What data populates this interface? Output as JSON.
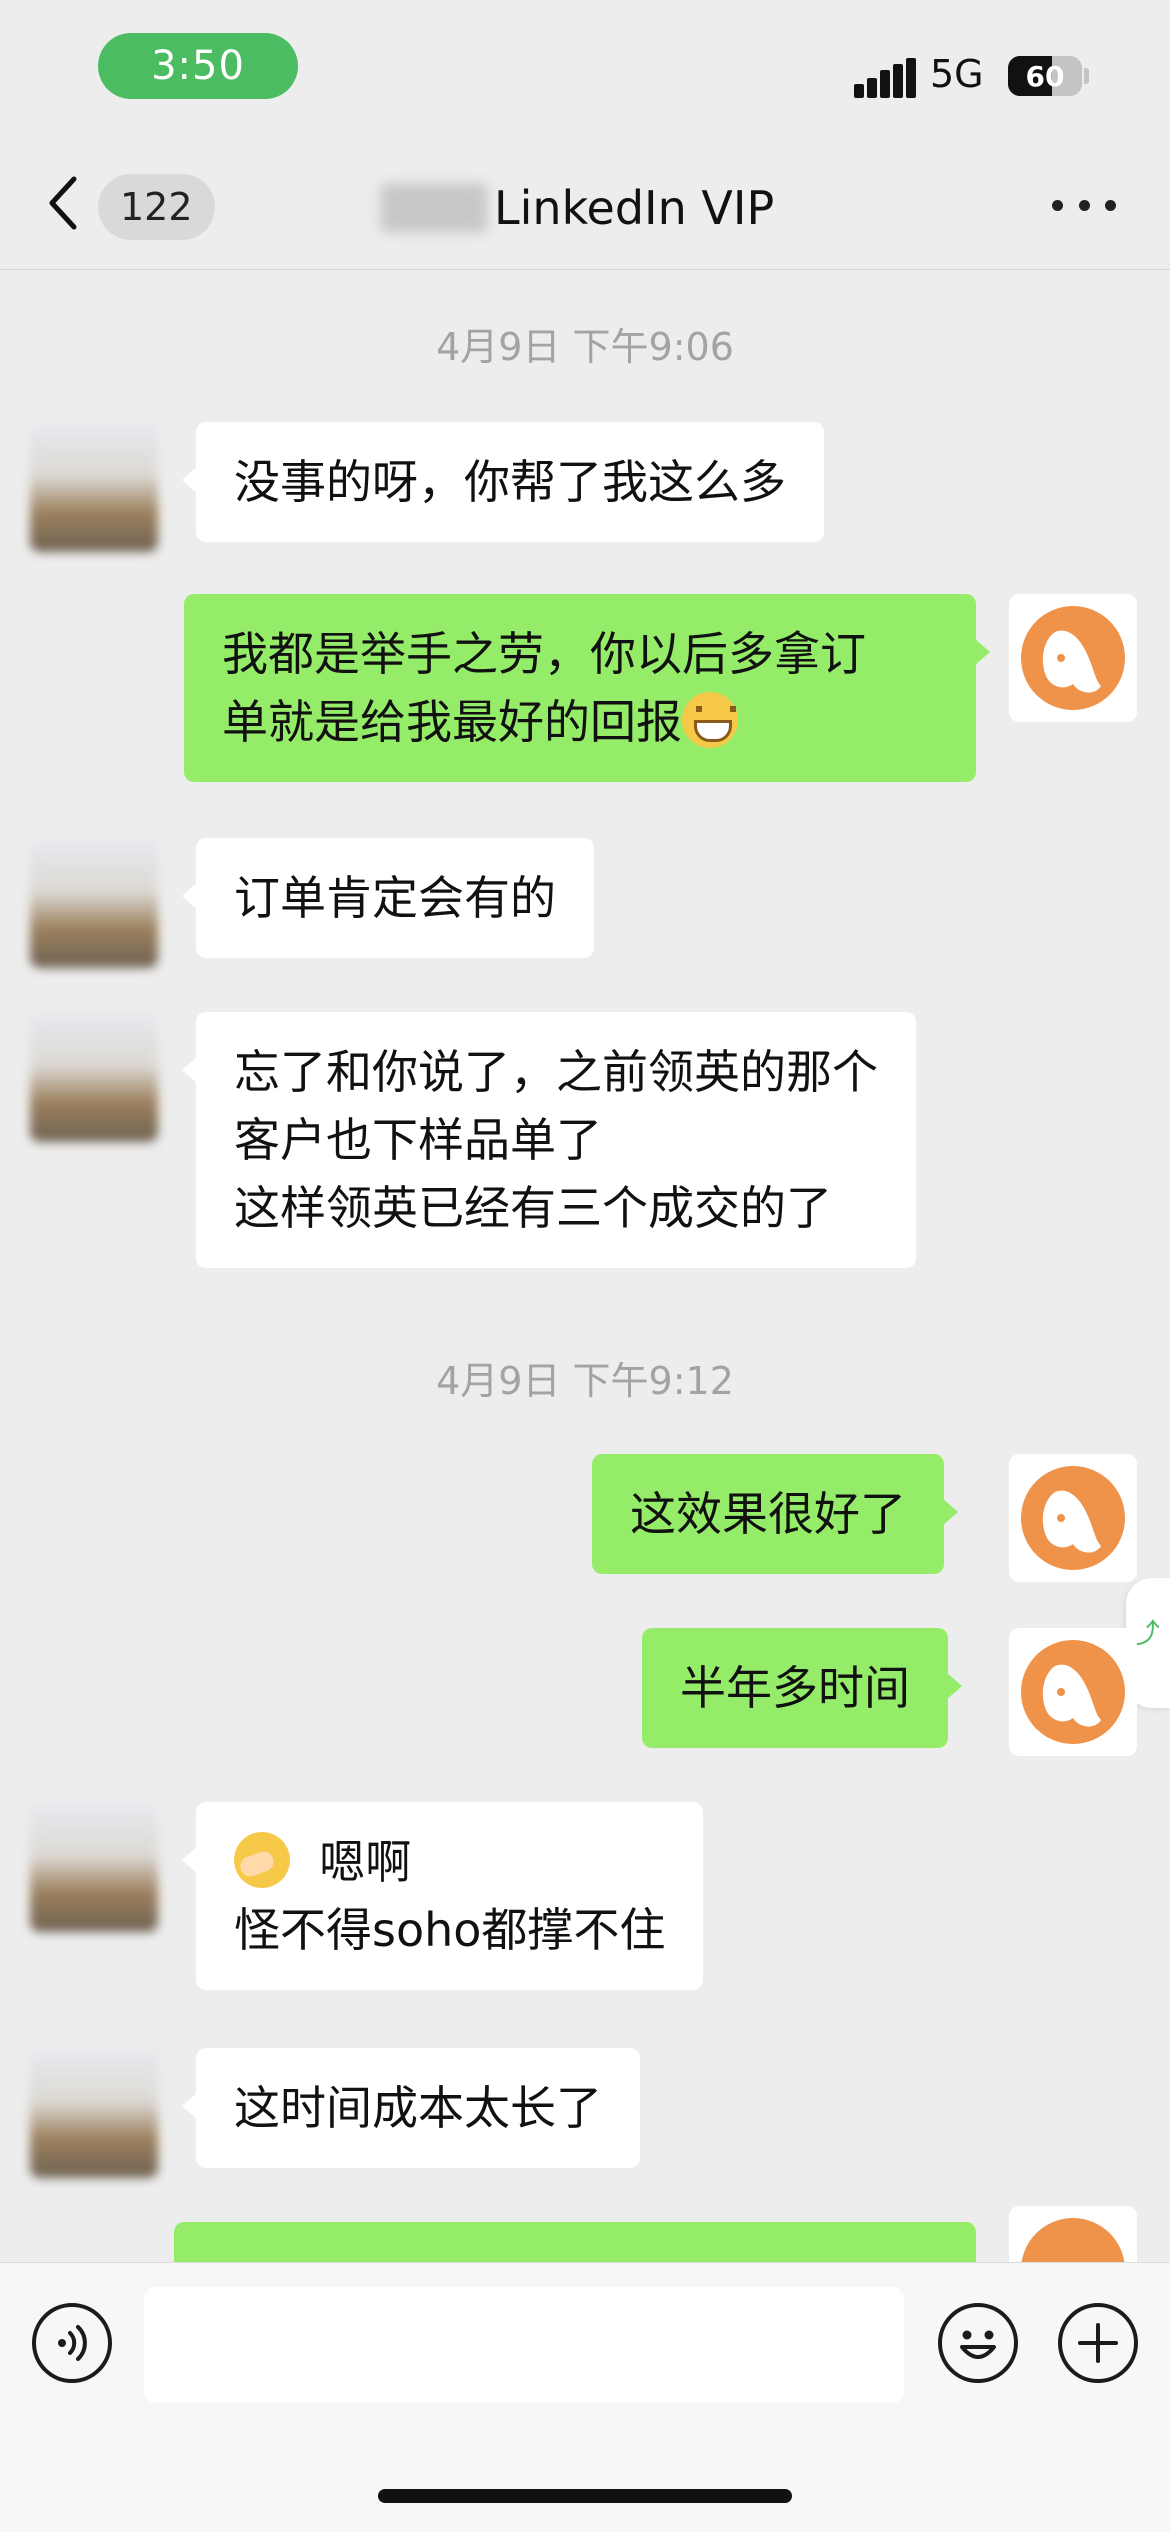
{
  "status_bar": {
    "time": "3:50",
    "network": "5G",
    "battery": "60",
    "battery_level_percent": 60
  },
  "nav": {
    "unread_count": "122",
    "title": "LinkedIn VIP"
  },
  "chat": {
    "timestamps": [
      "4月9日 下午9:06",
      "4月9日 下午9:12"
    ],
    "messages": [
      {
        "side": "left",
        "lines": [
          "没事的呀，你帮了我这么多"
        ]
      },
      {
        "side": "right",
        "lines": [
          "我都是举手之劳，你以后多拿订",
          "单就是给我最好的回报"
        ],
        "emoji": "grin-emoji"
      },
      {
        "side": "left",
        "lines": [
          "订单肯定会有的"
        ]
      },
      {
        "side": "left",
        "lines": [
          "忘了和你说了，之前领英的那个",
          "客户也下样品单了",
          "这样领英已经有三个成交的了"
        ]
      },
      {
        "side": "right",
        "lines": [
          "这效果很好了"
        ]
      },
      {
        "side": "right",
        "lines": [
          "半年多时间"
        ]
      },
      {
        "side": "left",
        "lines": [
          "嗯啊",
          "怪不得soho都撑不住"
        ],
        "emoji": "facepalm-emoji"
      },
      {
        "side": "left",
        "lines": [
          "这时间成本太长了"
        ]
      }
    ]
  },
  "colors": {
    "sent_bubble": "#95ec69",
    "received_bubble": "#ffffff",
    "chat_background": "#ededed",
    "time_pill": "#4cbc62",
    "avatar_orange": "#f0934a"
  },
  "icons": {
    "back": "chevron-left-icon",
    "more": "more-dots-icon",
    "voice": "voice-icon",
    "emoji": "smiley-icon",
    "plus": "plus-icon"
  }
}
